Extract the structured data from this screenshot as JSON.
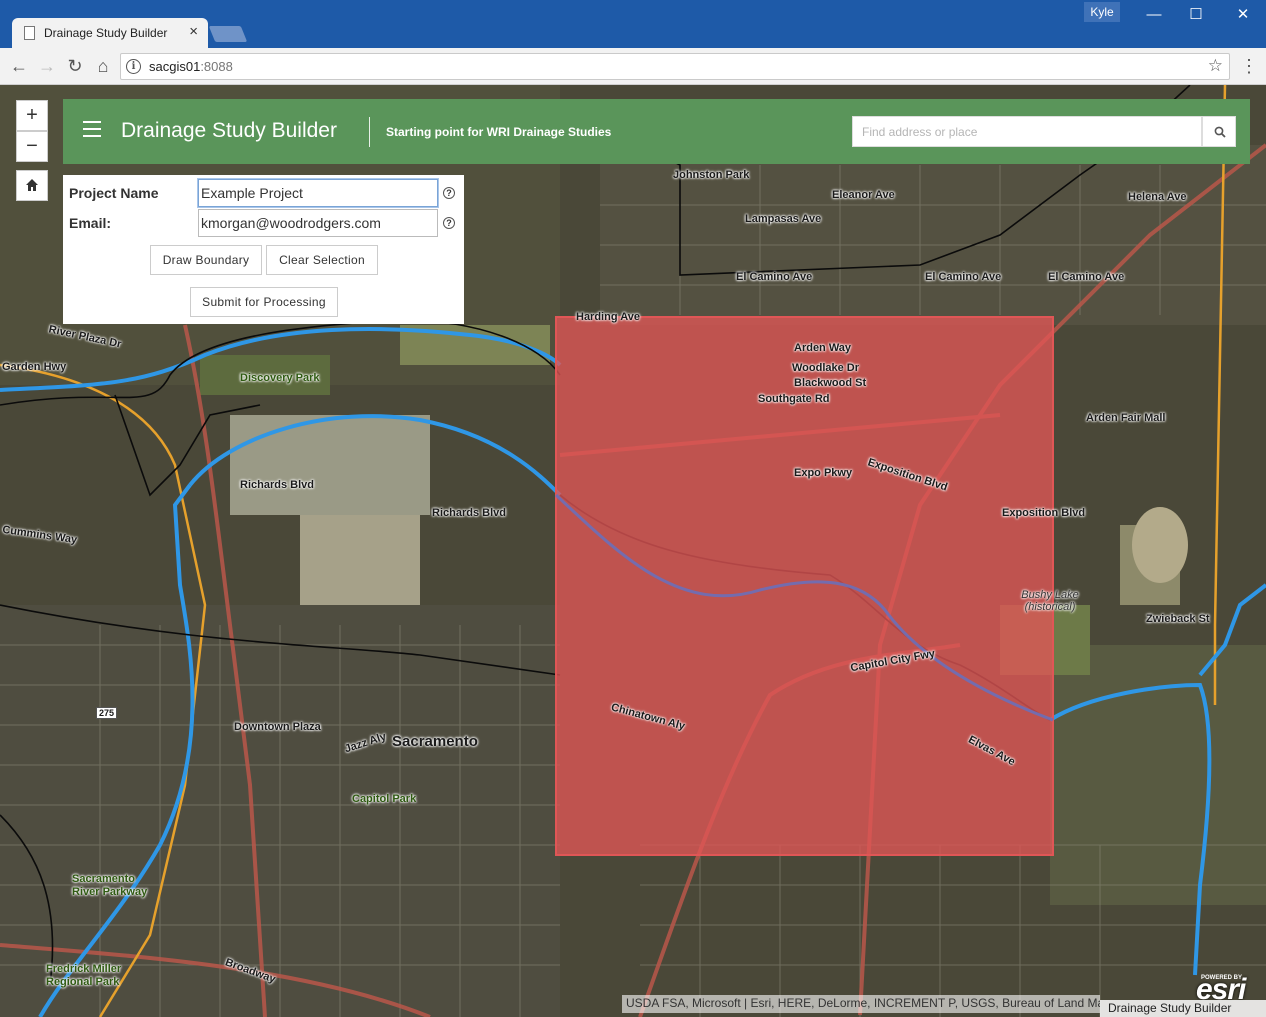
{
  "browser": {
    "tab_title": "Drainage Study Builder",
    "tab_close": "×",
    "user_badge": "Kyle",
    "minimize": "—",
    "maximize": "☐",
    "close": "✕",
    "url_host": "sacgis01",
    "url_port": ":8088",
    "back": "←",
    "forward": "→",
    "reload": "↻",
    "home": "⌂",
    "bookmark_star": "☆",
    "menu": "⋮"
  },
  "app": {
    "title": "Drainage Study Builder",
    "subtitle": "Starting point for WRI Drainage Studies",
    "search_placeholder": "Find address or place",
    "search_icon": "search-icon",
    "accent_color": "#5a955a"
  },
  "map_controls": {
    "zoom_in": "+",
    "zoom_out": "−",
    "home_icon": "home-icon"
  },
  "form": {
    "project_name_label": "Project Name",
    "project_name_value": "Example Project",
    "email_label": "Email:",
    "email_value": "kmorgan@woodrodgers.com",
    "help_glyph": "?",
    "draw_boundary": "Draw Boundary",
    "clear_selection": "Clear Selection",
    "submit": "Submit for Processing"
  },
  "selection": {
    "fill_color": "#e05656"
  },
  "attribution": "USDA FSA, Microsoft | Esri, HERE, DeLorme, INCREMENT P, USGS, Bureau of Land Management",
  "footer_title": "Drainage Study Builder",
  "esri": {
    "powered": "POWERED BY",
    "logo": "esri"
  },
  "map_labels": {
    "johnston_park": "Johnston Park",
    "eleanor_ave": "Eleanor Ave",
    "helena_ave": "Helena Ave",
    "lampasas_ave": "Lampasas Ave",
    "el_camino_1": "El Camino Ave",
    "el_camino_2": "El Camino Ave",
    "el_camino_3": "El Camino Ave",
    "harding_ave": "Harding Ave",
    "arden_way": "Arden Way",
    "woodlake_dr": "Woodlake Dr",
    "blackwood_st": "Blackwood St",
    "southgate_rd": "Southgate Rd",
    "expo_pkwy": "Expo Pkwy",
    "exposition_blvd": "Exposition Blvd",
    "exposition_blvd_2": "Exposition Blvd",
    "arden_fair_mall": "Arden Fair Mall",
    "discovery_park": "Discovery Park",
    "river_plaza_dr": "River Plaza Dr",
    "garden_hwy": "Garden Hwy",
    "richards_blvd": "Richards Blvd",
    "richards_blvd_2": "Richards Blvd",
    "cummins_way": "Cummins Way",
    "zwieback_st": "Zwieback St",
    "bushy_lake": "Bushy Lake (historical)",
    "capitol_city_fwy": "Capitol City Fwy",
    "chinatown_aly": "Chinatown Aly",
    "downtown_plaza": "Downtown Plaza",
    "sacramento": "Sacramento",
    "capitol_park": "Capitol Park",
    "sac_river_parkway": "Sacramento River Parkway",
    "fredrick_miller": "Fredrick Miller Regional Park",
    "broadway": "Broadway",
    "elvas_ave": "Elvas Ave",
    "jazz_aly": "Jazz Aly",
    "hwy_275": "275"
  }
}
